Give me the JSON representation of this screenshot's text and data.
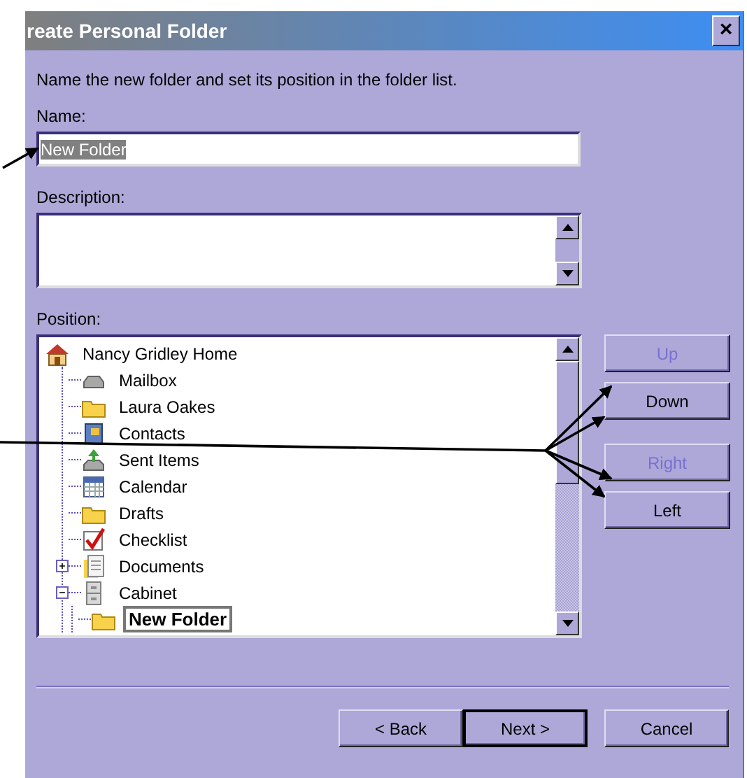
{
  "window": {
    "title": "reate Personal Folder",
    "close": "×"
  },
  "intro": "Name the new folder and set its position in the folder list.",
  "name_field": {
    "label": "Name:",
    "value": "New Folder",
    "text_selected": true
  },
  "description_field": {
    "label": "Description:"
  },
  "position": {
    "label": "Position:",
    "tree": [
      {
        "label": "Nancy Gridley Home",
        "kind": "home",
        "selected": false,
        "children": [
          {
            "label": "Mailbox",
            "kind": "mailbox",
            "selected": false
          },
          {
            "label": "Laura Oakes",
            "kind": "folder",
            "selected": false
          },
          {
            "label": "Contacts",
            "kind": "contacts",
            "selected": false
          },
          {
            "label": "Sent Items",
            "kind": "sent",
            "selected": false
          },
          {
            "label": "Calendar",
            "kind": "calendar",
            "selected": false
          },
          {
            "label": "Drafts",
            "kind": "folder",
            "selected": false
          },
          {
            "label": "Checklist",
            "kind": "checklist",
            "selected": false
          },
          {
            "label": "Documents",
            "kind": "documents",
            "selected": false,
            "expanded": false
          },
          {
            "label": "Cabinet",
            "kind": "cabinet",
            "selected": false,
            "expanded": true,
            "children": [
              {
                "label": "New Folder",
                "kind": "folder",
                "selected": true
              }
            ]
          }
        ]
      }
    ]
  },
  "move_buttons": [
    {
      "label": "Up",
      "disabled": true
    },
    {
      "label": "Down",
      "disabled": false
    },
    {
      "label": "Right",
      "disabled": true
    },
    {
      "label": "Left",
      "disabled": false
    }
  ],
  "footer_buttons": [
    {
      "label": "< Back",
      "default": false
    },
    {
      "label": "Next >",
      "default": true
    },
    {
      "label": "Cancel",
      "default": false
    }
  ]
}
